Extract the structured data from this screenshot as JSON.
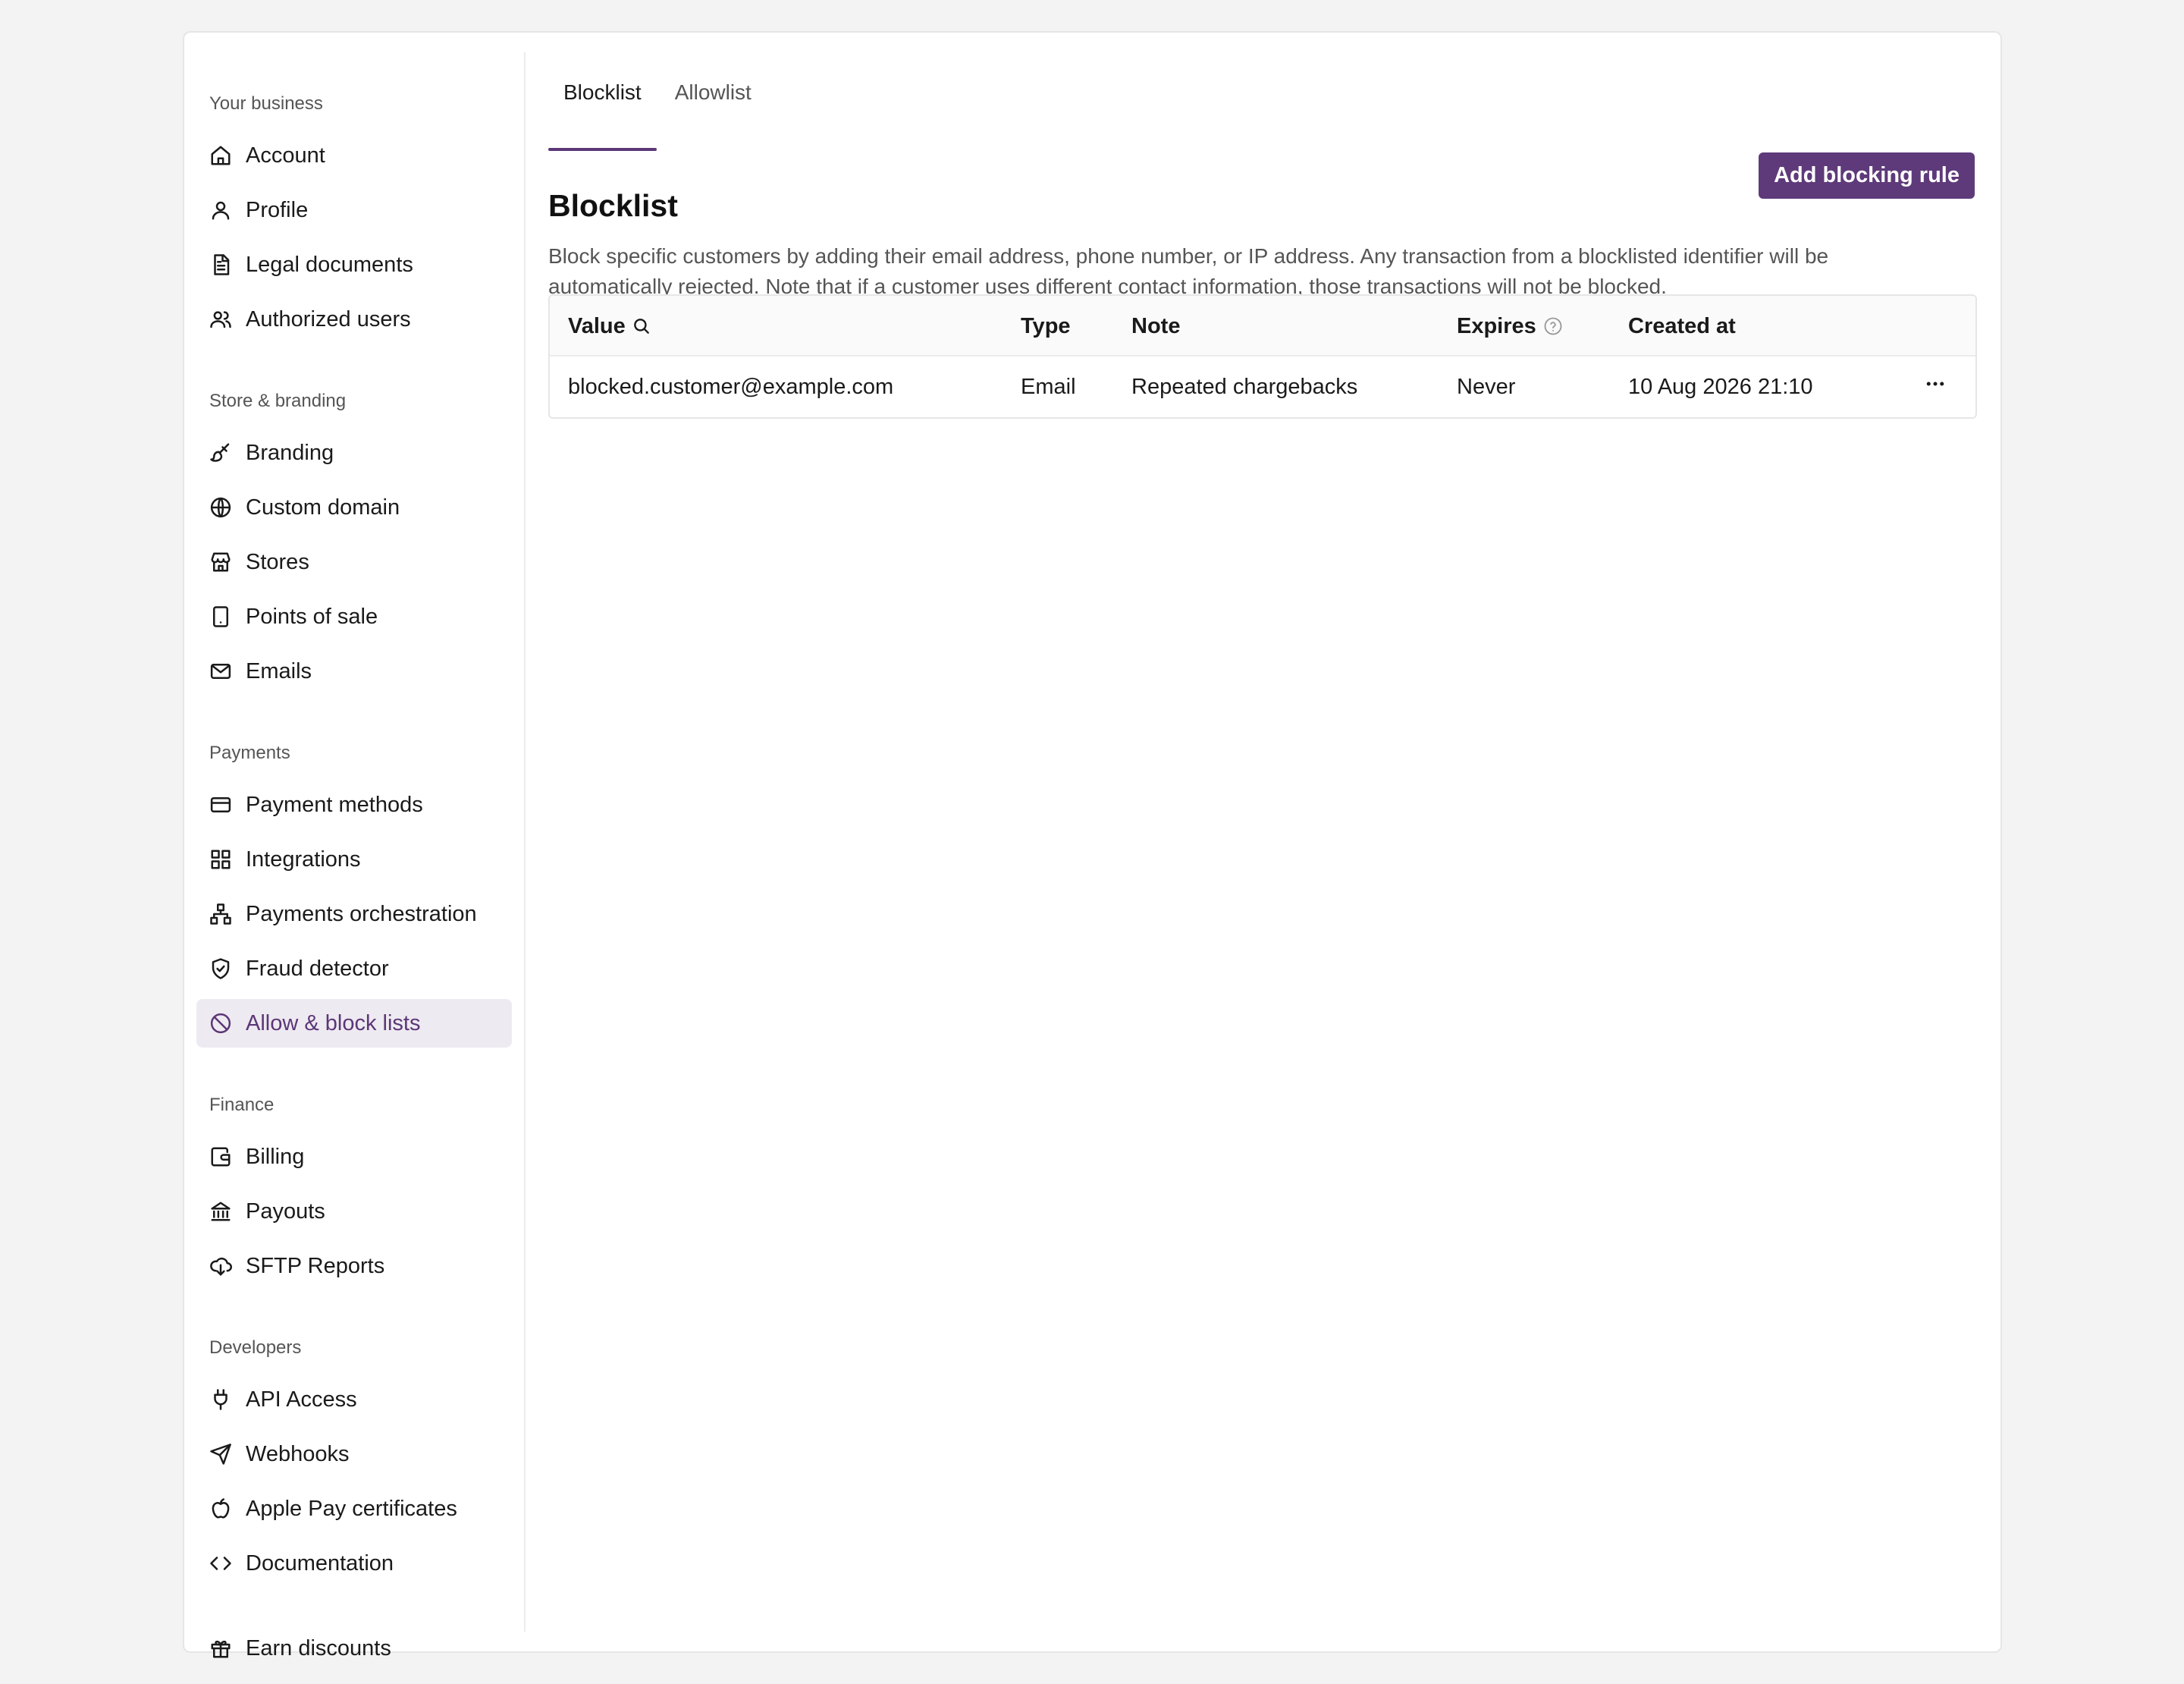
{
  "sidebar": {
    "sections": {
      "business": "Your business",
      "store": "Store & branding",
      "payments": "Payments",
      "finance": "Finance",
      "developers": "Developers"
    },
    "items": {
      "account": "Account",
      "profile": "Profile",
      "legal": "Legal documents",
      "authorized": "Authorized users",
      "branding": "Branding",
      "domain": "Custom domain",
      "stores": "Stores",
      "pos": "Points of sale",
      "emails": "Emails",
      "payment_methods": "Payment methods",
      "integrations": "Integrations",
      "orchestration": "Payments orchestration",
      "fraud": "Fraud detector",
      "lists": "Allow & block lists",
      "billing": "Billing",
      "payouts": "Payouts",
      "sftp": "SFTP Reports",
      "api": "API Access",
      "webhooks": "Webhooks",
      "applepay": "Apple Pay certificates",
      "docs": "Documentation",
      "discounts": "Earn discounts"
    },
    "active_item": "Allow & block lists"
  },
  "tabs": {
    "blocklist": "Blocklist",
    "allowlist": "Allowlist"
  },
  "page": {
    "title": "Blocklist",
    "add_button": "Add blocking rule",
    "description": "Block specific customers by adding their email address, phone number, or IP address. Any transaction from a blocklisted identifier will be automatically rejected. Note that if a customer uses different contact information, those transactions will not be blocked."
  },
  "table": {
    "headers": {
      "value": "Value",
      "type": "Type",
      "note": "Note",
      "expires": "Expires",
      "created": "Created at"
    },
    "rows": [
      {
        "value": "blocked.customer@example.com",
        "type": "Email",
        "note": "Repeated chargebacks",
        "expires": "Never",
        "created": "10 Aug 2026 21:10"
      }
    ]
  },
  "colors": {
    "accent": "#5e3a7a",
    "active_bg": "#eeeaf1"
  }
}
